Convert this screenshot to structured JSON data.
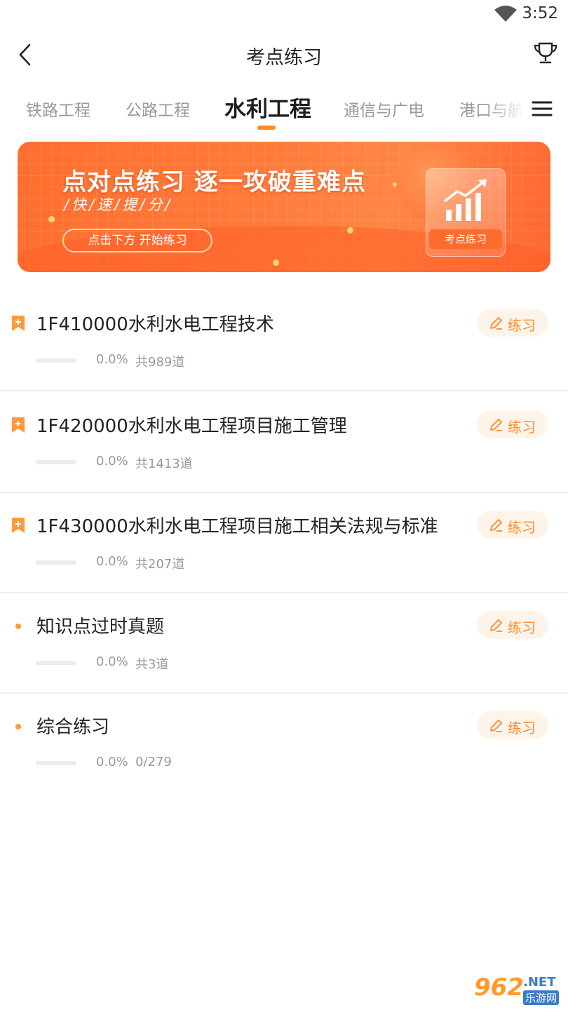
{
  "status_bar": {
    "time": "3:52"
  },
  "header": {
    "title": "考点练习"
  },
  "tabs": [
    {
      "label": "铁路工程"
    },
    {
      "label": "公路工程"
    },
    {
      "label": "水利工程",
      "active": true
    },
    {
      "label": "通信与广电"
    },
    {
      "label": "港口与航"
    }
  ],
  "banner": {
    "headline": "点对点练习 逐一攻破重难点",
    "subline": "/快/速/提/分/",
    "cta": "点击下方 开始练习",
    "card_label": "考点练习"
  },
  "items": [
    {
      "title": "1F410000水利水电工程技术",
      "icon": "bookmark-plus-icon",
      "button": "练习",
      "progress": 0.0,
      "progress_text": "0.0%",
      "count": "共989道"
    },
    {
      "title": "1F420000水利水电工程项目施工管理",
      "icon": "bookmark-plus-icon",
      "button": "练习",
      "progress": 0.0,
      "progress_text": "0.0%",
      "count": "共1413道"
    },
    {
      "title": "1F430000水利水电工程项目施工相关法规与标准",
      "icon": "bookmark-plus-icon",
      "button": "练习",
      "progress": 0.0,
      "progress_text": "0.0%",
      "count": "共207道"
    },
    {
      "title": "知识点过时真题",
      "icon": "bullet-icon",
      "button": "练习",
      "progress": 0.0,
      "progress_text": "0.0%",
      "count": "共3道"
    },
    {
      "title": "综合练习",
      "icon": "bullet-icon",
      "button": "练习",
      "progress": 0.0,
      "progress_text": "0.0%",
      "count": "0/279"
    }
  ],
  "watermark": {
    "number": "962",
    "domain": ".NET",
    "site": "乐游网"
  },
  "colors": {
    "accent": "#ff8a2a",
    "banner": "#ff6e2e",
    "text": "#222222",
    "muted": "#999999"
  }
}
